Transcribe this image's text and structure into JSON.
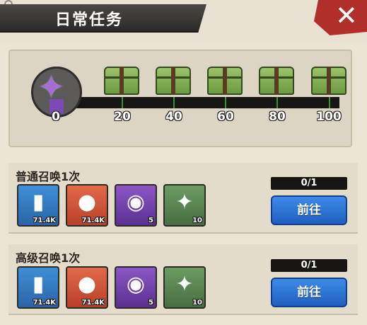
{
  "header": {
    "title": "日常任务",
    "close_icon": "close-icon"
  },
  "progress": {
    "current_label": "0",
    "milestones": [
      "20",
      "40",
      "60",
      "80",
      "100"
    ]
  },
  "tasks": [
    {
      "title": "普通召唤1次",
      "progress": "0/1",
      "button": "前往",
      "rewards": [
        {
          "icon": "energy-can-icon",
          "count": "71.4K"
        },
        {
          "icon": "bottle-cap-icon",
          "count": "71.4K"
        },
        {
          "icon": "purple-orb-icon",
          "count": "5"
        },
        {
          "icon": "purple-star-icon",
          "count": "10"
        }
      ]
    },
    {
      "title": "高级召唤1次",
      "progress": "0/1",
      "button": "前往",
      "rewards": [
        {
          "icon": "energy-can-icon",
          "count": "71.4K"
        },
        {
          "icon": "bottle-cap-icon",
          "count": "71.4K"
        },
        {
          "icon": "purple-orb-icon",
          "count": "5"
        },
        {
          "icon": "purple-star-icon",
          "count": "10"
        }
      ]
    }
  ]
}
